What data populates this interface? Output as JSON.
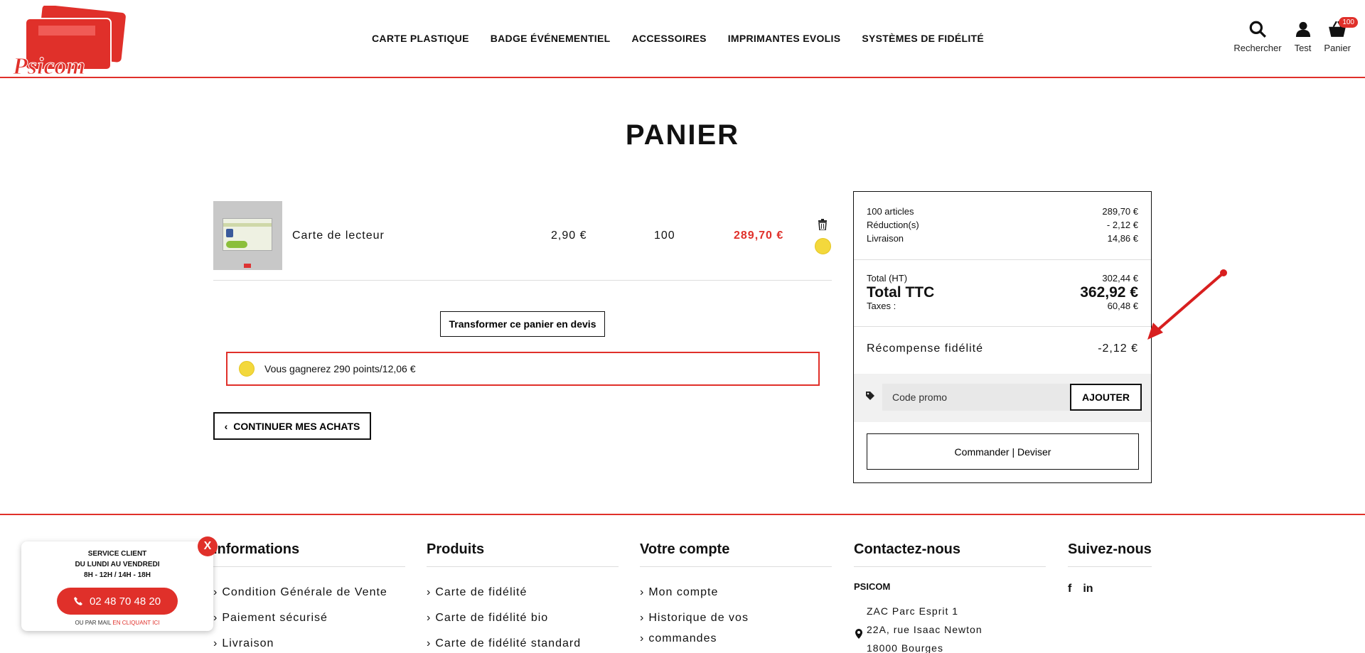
{
  "brand": {
    "logo_text": "Psicom",
    "accent": "#e0302a"
  },
  "nav": [
    "CARTE PLASTIQUE",
    "BADGE ÉVÉNEMENTIEL",
    "ACCESSOIRES",
    "IMPRIMANTES EVOLIS",
    "SYSTÈMES DE FIDÉLITÉ"
  ],
  "header_icons": {
    "search": "Rechercher",
    "account": "Test",
    "cart": "Panier",
    "cart_count": "100"
  },
  "page_title": "PANIER",
  "cart_line": {
    "name": "Carte de lecteur",
    "unit_price": "2,90 €",
    "qty": "100",
    "total": "289,70 €"
  },
  "buttons": {
    "devis": "Transformer ce panier en devis",
    "continue": "CONTINUER MES ACHATS"
  },
  "points_text": "Vous gagnerez 290 points/12,06 €",
  "summary": {
    "articles_label": "100 articles",
    "articles_value": "289,70 €",
    "reduction_label": "Réduction(s)",
    "reduction_value": "- 2,12 €",
    "shipping_label": "Livraison",
    "shipping_value": "14,86 €",
    "total_ht_label": "Total (HT)",
    "total_ht_value": "302,44 €",
    "total_ttc_label": "Total TTC",
    "total_ttc_value": "362,92 €",
    "taxes_label": "Taxes :",
    "taxes_value": "60,48 €",
    "reward_label": "Récompense fidélité",
    "reward_value": "-2,12 €",
    "promo_placeholder": "Code promo",
    "add_button": "AJOUTER",
    "order_button": "Commander | Deviser"
  },
  "footer": {
    "informations": {
      "title": "Informations",
      "items": [
        "Condition Générale de Vente",
        "Paiement sécurisé",
        "Livraison"
      ]
    },
    "produits": {
      "title": "Produits",
      "items": [
        "Carte de fidélité",
        "Carte de fidélité bio",
        "Carte de fidélité standard"
      ]
    },
    "compte": {
      "title": "Votre compte",
      "items": [
        "Mon compte",
        "Historique de vos",
        "commandes"
      ]
    },
    "contact": {
      "title": "Contactez-nous",
      "company": "PSICOM",
      "address": [
        "ZAC Parc Esprit 1",
        "22A, rue Isaac Newton",
        "18000 Bourges"
      ]
    },
    "suivez": {
      "title": "Suivez-nous",
      "facebook": "f",
      "linkedin": "in"
    }
  },
  "service_popup": {
    "line1": "SERVICE CLIENT",
    "line2": "DU LUNDI AU VENDREDI",
    "line3": "8H - 12H / 14H - 18H",
    "phone": "02 48 70 48 20",
    "mail_prefix": "OU PAR MAIL",
    "mail_link": "EN CLIQUANT ICI",
    "close": "X"
  }
}
